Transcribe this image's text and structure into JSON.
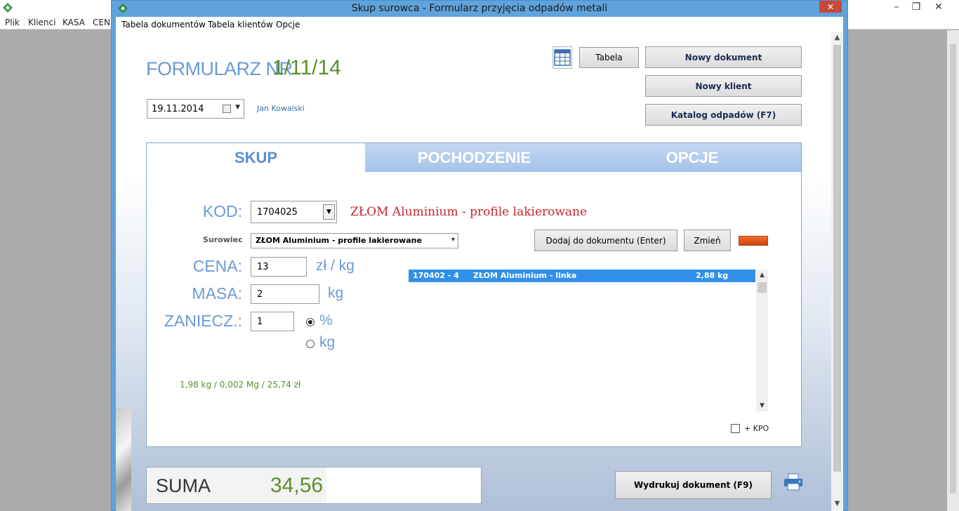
{
  "background_app": {
    "menu": [
      "Plik",
      "Klienci",
      "KASA",
      "CEN"
    ]
  },
  "window": {
    "title": "Skup surowca - Formularz przyjęcia odpadów metali",
    "close_icon": "close-icon"
  },
  "menu": [
    "Tabela dokumentów",
    "Tabela klientów",
    "Opcje"
  ],
  "header": {
    "form_label": "FORMULARZ NR",
    "form_number": "1/11/14",
    "date": "19.11.2014",
    "user": "Jan Kowalski"
  },
  "toolbar": {
    "table_label": "Tabela",
    "new_document": "Nowy dokument",
    "new_client": "Nowy klient",
    "catalog": "Katalog odpadów (F7)"
  },
  "tabs": [
    "SKUP",
    "POCHODZENIE",
    "OPCJE"
  ],
  "form": {
    "kod_label": "KOD:",
    "kod_value": "1704025",
    "material_name": "ZŁOM Aluminium - profile lakierowane",
    "surowiec_label": "Surowiec",
    "surowiec_value": "ZŁOM Aluminium - profile lakierowane",
    "add_button": "Dodaj do dokumentu (Enter)",
    "change_button": "Zmień",
    "cena_label": "CENA:",
    "cena_value": "13",
    "cena_unit": "zł / kg",
    "masa_label": "MASA:",
    "masa_value": "2",
    "masa_unit": "kg",
    "zaniecz_label": "ZANIECZ.:",
    "zaniecz_value": "1",
    "radio_percent": "%",
    "radio_kg": "kg",
    "summary": "1,98 kg / 0,002 Mg / 25,74 zł",
    "kpo_label": "+ KPO"
  },
  "list": {
    "rows": [
      {
        "code": "170402 - 4",
        "name": "ZŁOM Aluminium - linka",
        "mass": "2,88 kg"
      }
    ]
  },
  "footer": {
    "sum_label": "SUMA",
    "sum_value": "34,56",
    "print_button": "Wydrukuj dokument (F9)"
  },
  "colors": {
    "accent_blue": "#6a9ad4",
    "value_green": "#5b8f2b",
    "material_red": "#c4262d",
    "selection_blue": "#3390e8"
  }
}
